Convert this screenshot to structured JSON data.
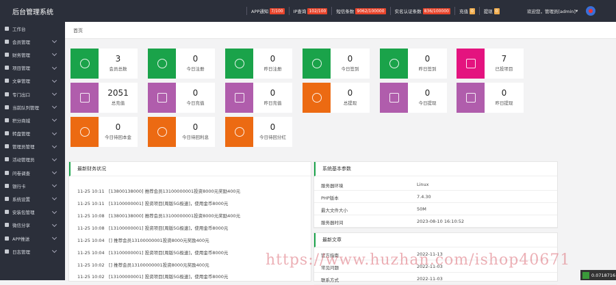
{
  "app": {
    "title": "后台管理系统"
  },
  "topbar": {
    "stats": [
      {
        "label": "APP通知",
        "badge": "7/100"
      },
      {
        "label": "IP查询",
        "badge": "102/100"
      },
      {
        "label": "短信条数",
        "badge": "9062/100000"
      },
      {
        "label": "实名认证条数",
        "badge": "836/100000"
      },
      {
        "label": "充值",
        "badge": "0"
      },
      {
        "label": "提现",
        "badge": "0"
      }
    ],
    "welcome": "欢迎您，管理员[admin]"
  },
  "sidebar": {
    "items": [
      {
        "label": "工作台"
      },
      {
        "label": "会员管理"
      },
      {
        "label": "财务管理"
      },
      {
        "label": "项目管理"
      },
      {
        "label": "文章管理"
      },
      {
        "label": "专门出口"
      },
      {
        "label": "当前队列管理"
      },
      {
        "label": "积分商城"
      },
      {
        "label": "转盘管理"
      },
      {
        "label": "管理员管理"
      },
      {
        "label": "活动管理员"
      },
      {
        "label": "问卷调查"
      },
      {
        "label": "银行卡"
      },
      {
        "label": "系统设置"
      },
      {
        "label": "安装包管理"
      },
      {
        "label": "微信分享"
      },
      {
        "label": "APP推送"
      },
      {
        "label": "日志管理"
      }
    ]
  },
  "breadcrumb": "首页",
  "cards": [
    {
      "value": "3",
      "label": "会员总数",
      "color": "#1aa34a"
    },
    {
      "value": "0",
      "label": "今日注册",
      "color": "#1aa34a"
    },
    {
      "value": "0",
      "label": "昨日注册",
      "color": "#1aa34a"
    },
    {
      "value": "0",
      "label": "今日签到",
      "color": "#1aa34a"
    },
    {
      "value": "0",
      "label": "昨日签到",
      "color": "#1aa34a"
    },
    {
      "value": "7",
      "label": "已投项目",
      "color": "#e4137f"
    },
    {
      "value": "2051",
      "label": "总充值",
      "color": "#b05dac"
    },
    {
      "value": "0",
      "label": "今日充值",
      "color": "#b05dac"
    },
    {
      "value": "0",
      "label": "昨日充值",
      "color": "#b05dac"
    },
    {
      "value": "0",
      "label": "总提现",
      "color": "#ec6a12"
    },
    {
      "value": "0",
      "label": "今日提现",
      "color": "#b05dac"
    },
    {
      "value": "0",
      "label": "昨日提现",
      "color": "#b05dac"
    },
    {
      "value": "0",
      "label": "今日待回本金",
      "color": "#ec6a12"
    },
    {
      "value": "0",
      "label": "今日待回利息",
      "color": "#ec6a12"
    },
    {
      "value": "0",
      "label": "今日待回分红",
      "color": "#ec6a12"
    }
  ],
  "finance": {
    "title": "最新财务状况",
    "rows": [
      {
        "time": "11-25 10:11",
        "text": "[13800138000] 推荐会员13100000001投资8000元奖励400元"
      },
      {
        "time": "11-25 10:11",
        "text": "[13100000001] 投资项目[周版5G极速]，使用金币8000元"
      },
      {
        "time": "11-25 10:08",
        "text": "[13800138000] 推荐会员13100000001投资8000元奖励400元"
      },
      {
        "time": "11-25 10:08",
        "text": "[13100000001] 投资项目[周版5G极速]，使用金币8000元"
      },
      {
        "time": "11-25 10:04",
        "text": "[] 推荐会员13100000001投资8000元奖励400元"
      },
      {
        "time": "11-25 10:04",
        "text": "[13100000001] 投资项目[周版5G极速]，使用金币8000元"
      },
      {
        "time": "11-25 10:02",
        "text": "[] 推荐会员13100000001投资8000元奖励400元"
      },
      {
        "time": "11-25 10:02",
        "text": "[13100000001] 投资项目[周版5G极速]，使用金币8000元"
      }
    ]
  },
  "sysparams": {
    "title": "系统基本参数",
    "rows": [
      {
        "k": "服务器环境",
        "v": "Linux"
      },
      {
        "k": "PHP版本",
        "v": "7.4.30"
      },
      {
        "k": "最大文件大小",
        "v": "50M"
      },
      {
        "k": "服务器时间",
        "v": "2023-08-10 16:10:52"
      }
    ]
  },
  "articles": {
    "title": "最新文章",
    "rows": [
      {
        "k": "官方指南",
        "v": "2022-11-13"
      },
      {
        "k": "常见问题",
        "v": "2022-11-03"
      },
      {
        "k": "联系方式",
        "v": "2022-11-03"
      }
    ]
  },
  "watermark": "https://www.huzhan.com/ishop40671",
  "corner_text": "0.0718716"
}
